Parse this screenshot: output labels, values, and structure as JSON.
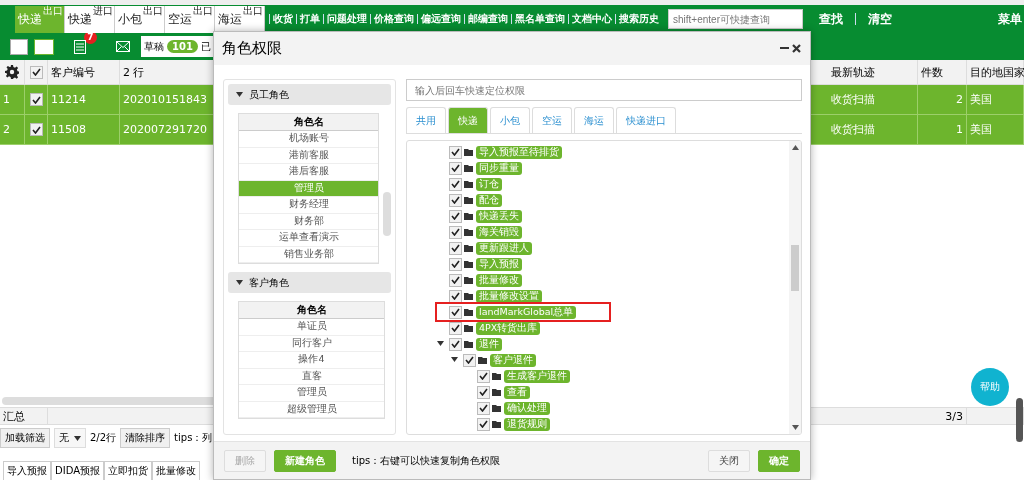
{
  "top_nav": {
    "tabs": [
      {
        "label": "快递",
        "tag": "出口",
        "selected": true
      },
      {
        "label": "快递",
        "tag": "进口",
        "selected": false
      },
      {
        "label": "小包",
        "tag": "出口",
        "selected": false
      },
      {
        "label": "空运",
        "tag": "出口",
        "selected": false
      },
      {
        "label": "海运",
        "tag": "出口",
        "selected": false
      }
    ],
    "links": [
      "收货",
      "打单",
      "问题处理",
      "价格查询",
      "偏远查询",
      "邮编查询",
      "黑名单查询",
      "文档中心",
      "搜索历史"
    ],
    "search": {
      "placeholder": "shift+enter可快捷查询"
    },
    "buttons": [
      "查找",
      "清空"
    ],
    "menu": "菜单"
  },
  "toolbar": {
    "badge": "7",
    "draft": {
      "label": "草稿",
      "count": "101"
    },
    "next_label": "已"
  },
  "table": {
    "header_checked": true,
    "columns_left": [
      "客户编号",
      "2 行"
    ],
    "columns_right": [
      "最新轨迹",
      "件数",
      "目的地国家"
    ],
    "rows": [
      {
        "index": "1",
        "checked": true,
        "customer_no": "11214",
        "column_2": "202010151843",
        "track": "收货扫描",
        "pieces": "2",
        "country": "美国"
      },
      {
        "index": "2",
        "checked": true,
        "customer_no": "11508",
        "column_2": "202007291720",
        "track": "收货扫描",
        "pieces": "1",
        "country": "美国"
      }
    ]
  },
  "summary": {
    "label": "汇总",
    "count": "3/3"
  },
  "filter_bar": {
    "load_filter": "加载筛选",
    "select_value": "无",
    "rows": "2/2行",
    "clear_sort": "清除排序",
    "tips": "tips：列"
  },
  "bottom_tabs": [
    "导入预报",
    "DIDA预报",
    "立即扣货",
    "批量修改"
  ],
  "help": "帮助",
  "dialog": {
    "title": "角色权限",
    "sections": [
      {
        "title": "员工角色",
        "expanded": true,
        "column": "角色名",
        "roles": [
          {
            "name": "机场账号",
            "selected": false
          },
          {
            "name": "港前客服",
            "selected": false
          },
          {
            "name": "港后客服",
            "selected": false
          },
          {
            "name": "管理员",
            "selected": true
          },
          {
            "name": "财务经理",
            "selected": false
          },
          {
            "name": "财务部",
            "selected": false
          },
          {
            "name": "运单查看演示",
            "selected": false
          },
          {
            "name": "销售业务部",
            "selected": false
          }
        ]
      },
      {
        "title": "客户角色",
        "expanded": true,
        "column": "角色名",
        "roles": [
          {
            "name": "单证员",
            "selected": false
          },
          {
            "name": "同行客户",
            "selected": false
          },
          {
            "name": "操作4",
            "selected": false
          },
          {
            "name": "直客",
            "selected": false
          },
          {
            "name": "管理员",
            "selected": false
          },
          {
            "name": "超级管理员",
            "selected": false
          }
        ]
      }
    ],
    "search": {
      "placeholder": "输入后回车快速定位权限"
    },
    "tabs": [
      {
        "label": "共用",
        "selected": false
      },
      {
        "label": "快递",
        "selected": true
      },
      {
        "label": "小包",
        "selected": false
      },
      {
        "label": "空运",
        "selected": false
      },
      {
        "label": "海运",
        "selected": false
      },
      {
        "label": "快递进口",
        "selected": false
      }
    ],
    "tree": [
      {
        "label": "导入预报至待排货",
        "checked": true
      },
      {
        "label": "同步重量",
        "checked": true
      },
      {
        "label": "订仓",
        "checked": true
      },
      {
        "label": "配仓",
        "checked": true
      },
      {
        "label": "快递丢失",
        "checked": true
      },
      {
        "label": "海关销毁",
        "checked": true
      },
      {
        "label": "更新跟进人",
        "checked": true
      },
      {
        "label": "导入预报",
        "checked": true
      },
      {
        "label": "批量修改",
        "checked": true
      },
      {
        "label": "批量修改设置",
        "checked": true
      },
      {
        "label": "landMarkGlobal总单",
        "checked": true,
        "highlighted": true
      },
      {
        "label": "4PX转货出库",
        "checked": true
      },
      {
        "label": "退件",
        "checked": true,
        "expanded": true,
        "children": [
          {
            "label": "客户退件",
            "checked": true,
            "expanded": true,
            "children": [
              {
                "label": "生成客户退件",
                "checked": true
              },
              {
                "label": "查看",
                "checked": true
              },
              {
                "label": "确认处理",
                "checked": true
              },
              {
                "label": "退货规则",
                "checked": true
              }
            ]
          }
        ]
      }
    ],
    "buttons": [
      {
        "label": "删除",
        "kind": "secondary",
        "disabled": true
      },
      {
        "label": "新建角色",
        "kind": "primary",
        "disabled": false
      }
    ],
    "tips": "tips：右键可以快速复制角色权限",
    "actions": [
      {
        "label": "关闭",
        "kind": "secondary",
        "disabled": false
      },
      {
        "label": "确定",
        "kind": "primary",
        "disabled": false
      }
    ]
  }
}
